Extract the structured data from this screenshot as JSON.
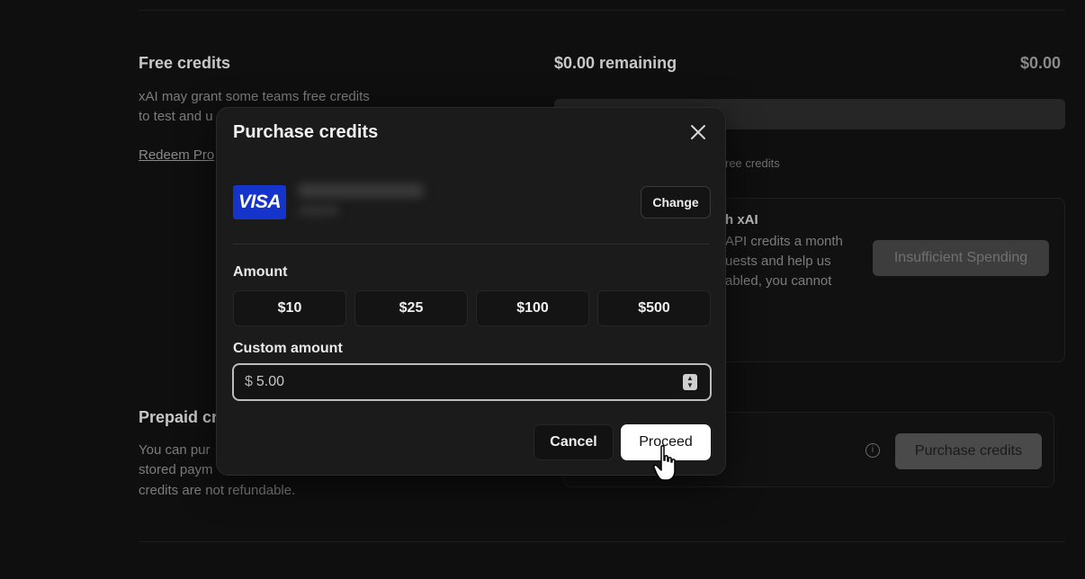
{
  "background": {
    "free_credits": {
      "title": "Free credits",
      "desc_line1": "xAI may grant some teams free credits",
      "desc_line2": "to test and u",
      "redeem_link": "Redeem Pro"
    },
    "remaining": {
      "label": "$0.00 remaining",
      "amount": "$0.00",
      "free_credits_note": "ree credits"
    },
    "program": {
      "title_fragment": "h xAI",
      "line1": "API credits a month",
      "line2": "uests and help us",
      "line3": "abled, you cannot",
      "button_label": "Insufficient Spending"
    },
    "prepaid": {
      "title": "Prepaid cr",
      "line1": "You can pur",
      "line2": "stored paym",
      "line3": "credits are not refundable.",
      "purchase_button": "Purchase credits"
    }
  },
  "modal": {
    "title": "Purchase credits",
    "card_brand": "VISA",
    "change_label": "Change",
    "amount_label": "Amount",
    "amounts": [
      "$10",
      "$25",
      "$100",
      "$500"
    ],
    "custom_amount_label": "Custom amount",
    "currency_symbol": "$",
    "custom_amount_value": "5.00",
    "cancel_label": "Cancel",
    "proceed_label": "Proceed"
  },
  "colors": {
    "visa_blue": "#1434cb",
    "proceed_bg": "#ffffff",
    "backdrop": "#0f0f0f"
  }
}
